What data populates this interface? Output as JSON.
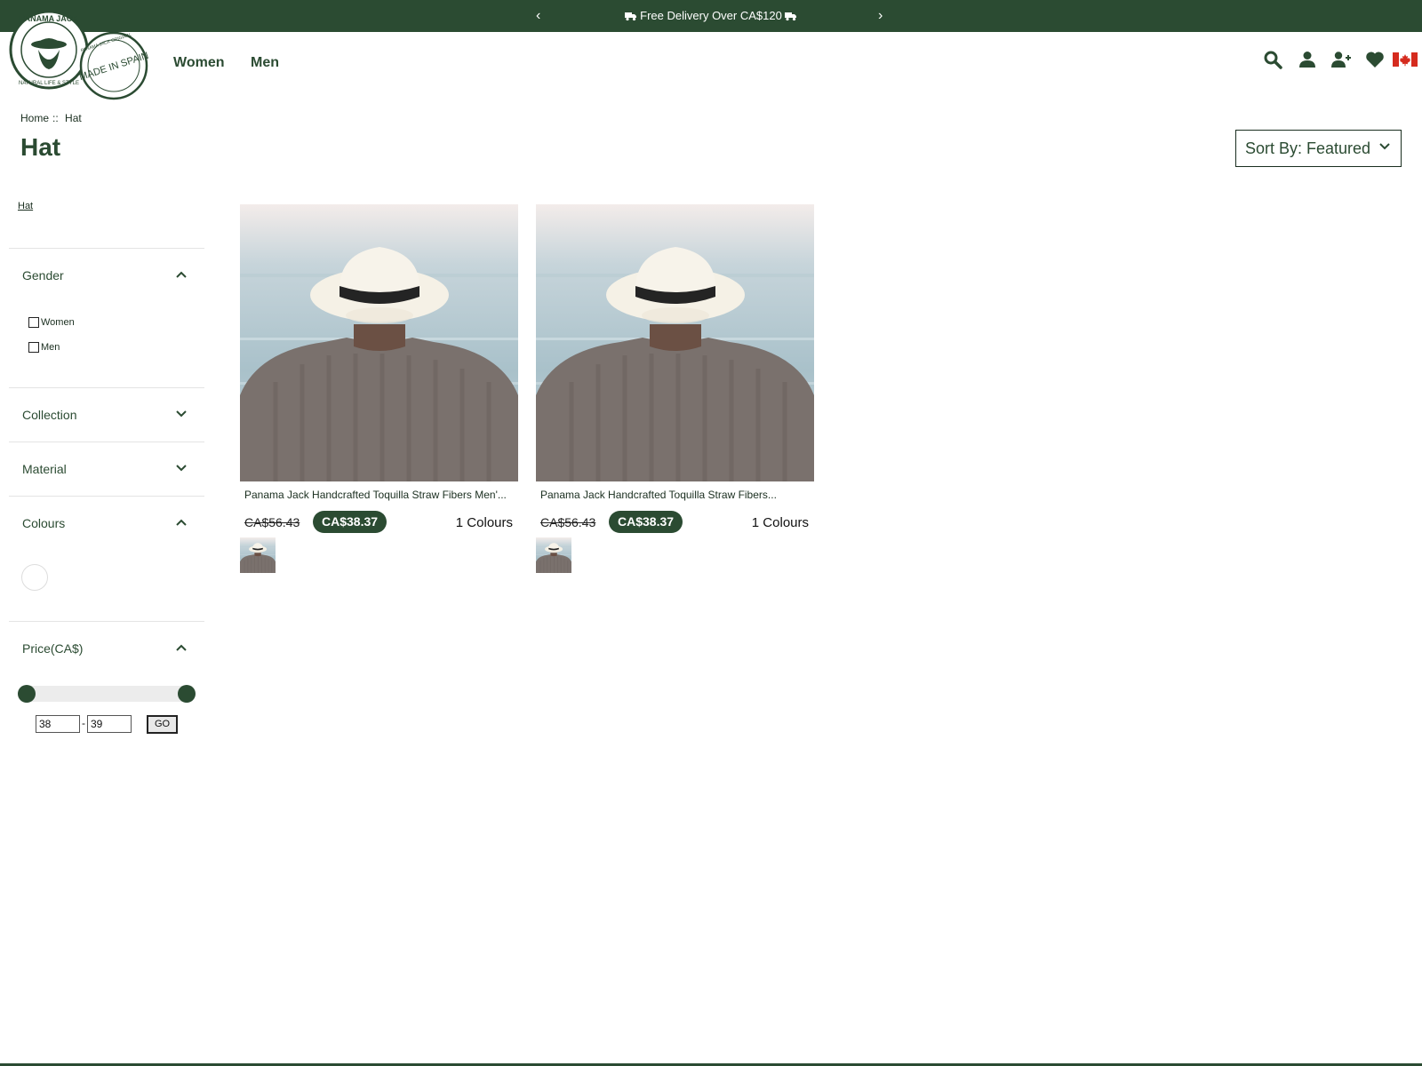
{
  "topbar": {
    "promo_text": "Free Delivery Over CA$120",
    "prev_arrow": "‹",
    "next_arrow": "›"
  },
  "logo": {
    "brand_text": "PANAMA JACK",
    "tagline": "NATURAL LIFE & STYLE",
    "stamp_text": "MADE IN SPAIN",
    "stamp_ring_text": "PANAMA JACK ORIGINAL"
  },
  "nav": {
    "women": "Women",
    "men": "Men"
  },
  "header_icons": [
    "search-icon",
    "account-icon",
    "add-user-icon",
    "wishlist-heart-icon",
    "canada-flag-icon"
  ],
  "breadcrumb": {
    "home": "Home",
    "separator": "::",
    "current": "Hat"
  },
  "page_title": "Hat",
  "sort": {
    "label": "Sort By: Featured"
  },
  "sidebar": {
    "category_link": "Hat",
    "filters": {
      "gender": {
        "title": "Gender",
        "options": [
          "Women",
          "Men"
        ]
      },
      "collection": {
        "title": "Collection"
      },
      "material": {
        "title": "Material"
      },
      "colours": {
        "title": "Colours",
        "swatch_color": "#ffffff"
      },
      "price": {
        "title": "Price(CA$)",
        "min_value": "38",
        "max_value": "39",
        "range_fill": [
          0,
          1
        ],
        "go_label": "GO"
      }
    }
  },
  "products": [
    {
      "name": "Panama Jack Handcrafted Toquilla Straw Fibers Men'...",
      "old_price": "CA$56.43",
      "price": "CA$38.37",
      "colours": "1 Colours"
    },
    {
      "name": "Panama Jack Handcrafted Toquilla Straw Fibers...",
      "old_price": "CA$56.43",
      "price": "CA$38.37",
      "colours": "1 Colours"
    }
  ],
  "colors": {
    "brand_green": "#2b4b32",
    "flag_red": "#d52b1e"
  }
}
